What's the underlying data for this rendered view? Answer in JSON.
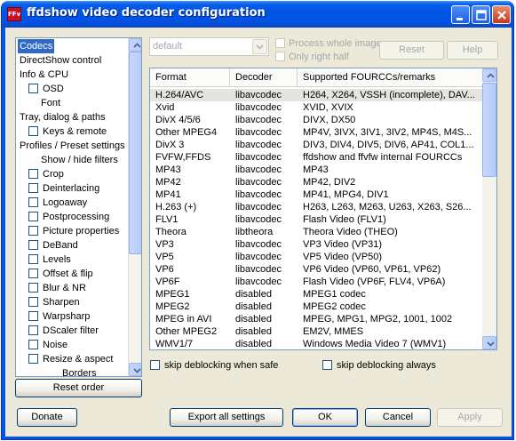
{
  "window": {
    "title": "ffdshow video decoder configuration",
    "icon_text": "FFv"
  },
  "tree": {
    "items": [
      {
        "label": "Codecs",
        "indent": 0,
        "checkbox": false,
        "selected": true
      },
      {
        "label": "DirectShow control",
        "indent": 0,
        "checkbox": false
      },
      {
        "label": "Info & CPU",
        "indent": 0,
        "checkbox": false
      },
      {
        "label": "OSD",
        "indent": 1,
        "checkbox": true
      },
      {
        "label": "Font",
        "indent": 2,
        "checkbox": false
      },
      {
        "label": "Tray, dialog & paths",
        "indent": 0,
        "checkbox": false
      },
      {
        "label": "Keys & remote",
        "indent": 1,
        "checkbox": true
      },
      {
        "label": "Profiles / Preset settings",
        "indent": 0,
        "checkbox": false
      },
      {
        "label": "Show / hide filters",
        "indent": 2,
        "checkbox": false
      },
      {
        "label": "Crop",
        "indent": 1,
        "checkbox": true
      },
      {
        "label": "Deinterlacing",
        "indent": 1,
        "checkbox": true
      },
      {
        "label": "Logoaway",
        "indent": 1,
        "checkbox": true
      },
      {
        "label": "Postprocessing",
        "indent": 1,
        "checkbox": true
      },
      {
        "label": "Picture properties",
        "indent": 1,
        "checkbox": true
      },
      {
        "label": "DeBand",
        "indent": 1,
        "checkbox": true
      },
      {
        "label": "Levels",
        "indent": 1,
        "checkbox": true
      },
      {
        "label": "Offset & flip",
        "indent": 1,
        "checkbox": true
      },
      {
        "label": "Blur & NR",
        "indent": 1,
        "checkbox": true
      },
      {
        "label": "Sharpen",
        "indent": 1,
        "checkbox": true
      },
      {
        "label": "Warpsharp",
        "indent": 1,
        "checkbox": true
      },
      {
        "label": "DScaler filter",
        "indent": 1,
        "checkbox": true
      },
      {
        "label": "Noise",
        "indent": 1,
        "checkbox": true
      },
      {
        "label": "Resize & aspect",
        "indent": 1,
        "checkbox": true
      },
      {
        "label": "Borders",
        "indent": 3,
        "checkbox": false
      }
    ]
  },
  "top": {
    "preset_value": "default",
    "process_whole_image": "Process whole image",
    "only_right_half": "Only right half",
    "reset_label": "Reset",
    "help_label": "Help"
  },
  "list": {
    "headers": [
      "Format",
      "Decoder",
      "Supported FOURCCs/remarks"
    ],
    "rows": [
      [
        "H.264/AVC",
        "libavcodec",
        "H264, X264, VSSH (incomplete), DAV..."
      ],
      [
        "Xvid",
        "libavcodec",
        "XVID, XVIX"
      ],
      [
        "DivX 4/5/6",
        "libavcodec",
        "DIVX, DX50"
      ],
      [
        "Other MPEG4",
        "libavcodec",
        "MP4V, 3IVX, 3IV1, 3IV2, MP4S, M4S..."
      ],
      [
        "DivX 3",
        "libavcodec",
        "DIV3, DIV4, DIV5, DIV6, AP41, COL1..."
      ],
      [
        "FVFW,FFDS",
        "libavcodec",
        "ffdshow and ffvfw internal FOURCCs"
      ],
      [
        "MP43",
        "libavcodec",
        "MP43"
      ],
      [
        "MP42",
        "libavcodec",
        "MP42, DIV2"
      ],
      [
        "MP41",
        "libavcodec",
        "MP41, MPG4, DIV1"
      ],
      [
        "H.263 (+)",
        "libavcodec",
        "H263, L263, M263, U263, X263, S26..."
      ],
      [
        "FLV1",
        "libavcodec",
        "Flash Video (FLV1)"
      ],
      [
        "Theora",
        "libtheora",
        "Theora Video (THEO)"
      ],
      [
        "VP3",
        "libavcodec",
        "VP3 Video (VP31)"
      ],
      [
        "VP5",
        "libavcodec",
        "VP5 Video (VP50)"
      ],
      [
        "VP6",
        "libavcodec",
        "VP6 Video (VP60, VP61, VP62)"
      ],
      [
        "VP6F",
        "libavcodec",
        "Flash Video (VP6F, FLV4, VP6A)"
      ],
      [
        "MPEG1",
        "disabled",
        "MPEG1 codec"
      ],
      [
        "MPEG2",
        "disabled",
        "MPEG2 codec"
      ],
      [
        "MPEG in AVI",
        "disabled",
        "MPEG, MPG1, MPG2, 1001, 1002"
      ],
      [
        "Other MPEG2",
        "disabled",
        "EM2V, MMES"
      ],
      [
        "WMV1/7",
        "disabled",
        "Windows Media Video 7 (WMV1)"
      ]
    ]
  },
  "options": {
    "skip_safe": "skip deblocking when safe",
    "skip_always": "skip deblocking always"
  },
  "buttons": {
    "reset_order": "Reset order",
    "donate": "Donate",
    "export_all": "Export all settings",
    "ok": "OK",
    "cancel": "Cancel",
    "apply": "Apply"
  },
  "colors": {
    "titlebar": "#0054e3",
    "selection": "#316ac5",
    "dialog_bg": "#ece9d8"
  }
}
